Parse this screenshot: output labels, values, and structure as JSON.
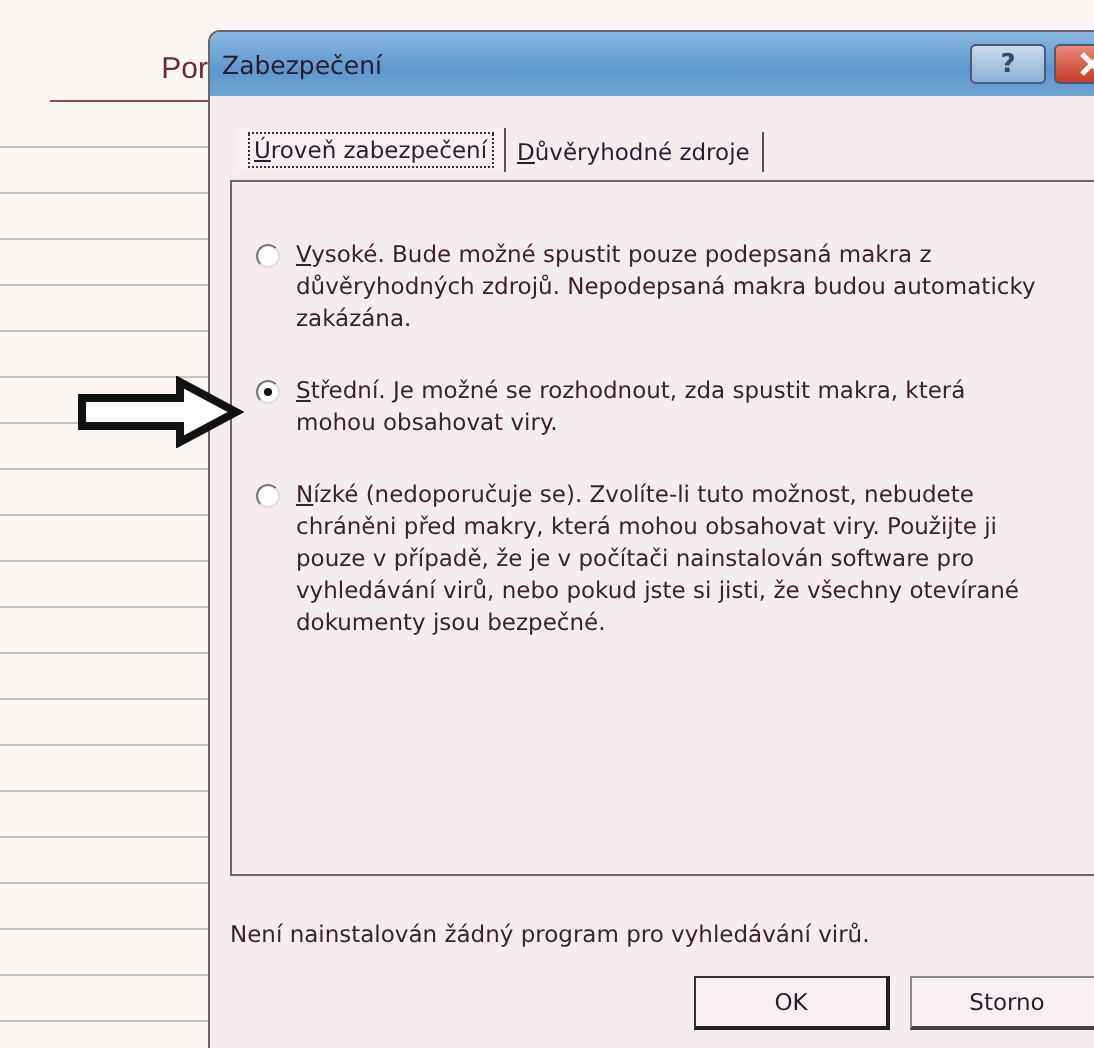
{
  "sheet": {
    "cell_text": "Por"
  },
  "window": {
    "title": "Zabezpečení",
    "help_label": "?"
  },
  "tabs": [
    {
      "label": "Úroveň zabezpečení",
      "selected": true
    },
    {
      "label": "Důvěryhodné zdroje",
      "selected": false
    }
  ],
  "options": [
    {
      "text": "Vysoké. Bude možné spustit pouze podepsaná makra z důvěryhodných zdrojů. Nepodepsaná makra budou automaticky zakázána.",
      "selected": false
    },
    {
      "text": "Střední. Je možné se rozhodnout, zda spustit makra, která mohou obsahovat viry.",
      "selected": true
    },
    {
      "text": "Nízké (nedoporučuje se). Zvolíte-li tuto možnost, nebudete chráněni před makry, která mohou obsahovat viry. Použijte ji pouze v případě, že je v počítači nainstalován software pro vyhledávání virů, nebo pokud jste si jisti, že všechny otevírané dokumenty jsou bezpečné.",
      "selected": false
    }
  ],
  "status_text": "Není nainstalován žádný program pro vyhledávání virů.",
  "buttons": [
    "OK",
    "Storno"
  ]
}
